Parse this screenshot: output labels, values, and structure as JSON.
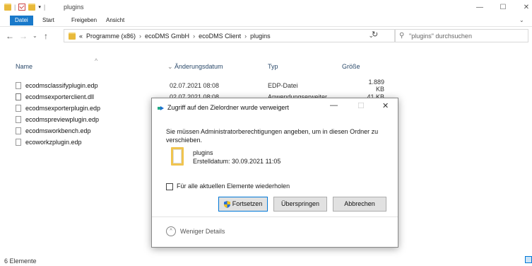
{
  "titlebar": {
    "title": "plugins",
    "minimize": "—",
    "maximize": "☐",
    "close": "✕"
  },
  "ribbon": {
    "tabs": [
      "Datei",
      "Start",
      "Freigeben",
      "Ansicht"
    ],
    "expand": "⌄"
  },
  "address": {
    "back": "←",
    "forward": "→",
    "recent": "⌄",
    "up": "↑",
    "overflow": "«",
    "crumbs": [
      "Programme (x86)",
      "ecoDMS GmbH",
      "ecoDMS Client",
      "plugins"
    ],
    "sep": "›",
    "dropdown": "⌄",
    "refresh": "↻",
    "search_placeholder": "\"plugins\" durchsuchen"
  },
  "columns": {
    "name": "Name",
    "date": "Änderungsdatum",
    "type": "Typ",
    "size": "Größe",
    "sort_arrow": "^",
    "date_arrow": "⌄"
  },
  "files": [
    {
      "name": "ecodmsclassifyplugin.edp",
      "date": "02.07.2021 08:08",
      "type": "EDP-Datei",
      "size": "1.889 KB"
    },
    {
      "name": "ecodmsexporterclient.dll",
      "date": "02.07.2021 08:08",
      "type": "Anwendungserweiter...",
      "size": "41 KB"
    },
    {
      "name": "ecodmsexporterplugin.edp",
      "date": "",
      "type": "",
      "size": ""
    },
    {
      "name": "ecodmspreviewplugin.edp",
      "date": "",
      "type": "",
      "size": ""
    },
    {
      "name": "ecodmsworkbench.edp",
      "date": "",
      "type": "",
      "size": ""
    },
    {
      "name": "ecoworkzplugin.edp",
      "date": "",
      "type": "",
      "size": ""
    }
  ],
  "status": {
    "count": "6 Elemente"
  },
  "dialog": {
    "title": "Zugriff auf den Zielordner wurde verweigert",
    "minimize": "—",
    "maximize": "☐",
    "close": "✕",
    "message": "Sie müssen Administratorberechtigungen angeben, um in diesen Ordner zu verschieben.",
    "folder_name": "plugins",
    "folder_date": "Erstelldatum: 30.09.2021 11:05",
    "repeat_label": "Für alle aktuellen Elemente wiederholen",
    "continue": "Fortsetzen",
    "skip": "Überspringen",
    "cancel": "Abbrechen",
    "less_icon": "^",
    "less_details": "Weniger Details"
  },
  "colors": {
    "accent": "#1979ca",
    "folder": "#e8b93a"
  }
}
